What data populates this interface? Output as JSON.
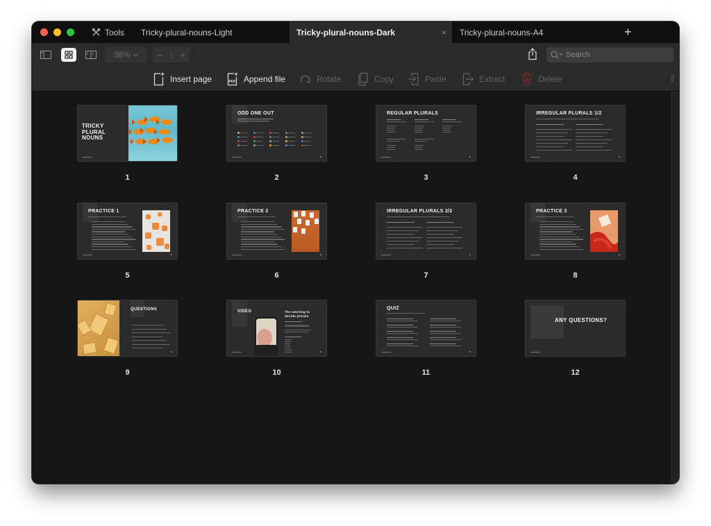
{
  "window": {
    "tools_label": "Tools",
    "tabs": [
      {
        "label": "Tricky-plural-nouns-Light",
        "active": false
      },
      {
        "label": "Tricky-plural-nouns-Dark",
        "active": true
      },
      {
        "label": "Tricky-plural-nouns-A4",
        "active": false
      }
    ],
    "close_tab_glyph": "×",
    "new_tab_glyph": "+"
  },
  "toolbar": {
    "view_modes": [
      {
        "icon": "sidebar-view-icon",
        "active": false
      },
      {
        "icon": "grid-view-icon",
        "active": true
      },
      {
        "icon": "two-page-view-icon",
        "active": false
      }
    ],
    "zoom_level": "38%",
    "zoom_minus": "−",
    "zoom_plus": "+",
    "search_placeholder": "Search"
  },
  "actions": [
    {
      "label": "Insert page",
      "icon": "insert-page-icon",
      "enabled": true
    },
    {
      "label": "Append file",
      "icon": "append-pdf-icon",
      "enabled": true
    },
    {
      "label": "Rotate",
      "icon": "rotate-icon",
      "enabled": false
    },
    {
      "label": "Copy",
      "icon": "copy-icon",
      "enabled": false
    },
    {
      "label": "Paste",
      "icon": "paste-icon",
      "enabled": false
    },
    {
      "label": "Extract",
      "icon": "extract-icon",
      "enabled": false
    },
    {
      "label": "Delete",
      "icon": "trash-icon",
      "enabled": false
    }
  ],
  "pages": [
    {
      "number": "1",
      "title": "TRICKY PLURAL NOUNS",
      "title_lines": [
        "TRICKY",
        "PLURAL",
        "NOUNS"
      ],
      "image": "goldfish"
    },
    {
      "number": "2",
      "title": "ODD ONE OUT"
    },
    {
      "number": "3",
      "title": "REGULAR PLURALS"
    },
    {
      "number": "4",
      "title": "IRREGULAR PLURALS 1/2"
    },
    {
      "number": "5",
      "title": "PRACTICE 1",
      "image": "orange-gummies"
    },
    {
      "number": "6",
      "title": "PRACTICE 2",
      "image": "white-chairs-orange"
    },
    {
      "number": "7",
      "title": "IRREGULAR PLURALS 2/2"
    },
    {
      "number": "8",
      "title": "PRACTICE 3",
      "image": "red-ribbon"
    },
    {
      "number": "9",
      "title": "QUESTIONS",
      "image": "yellow-books"
    },
    {
      "number": "10",
      "title": "VIDEO",
      "subtitle": "The meeting to decide plurals",
      "image": "phone-video"
    },
    {
      "number": "11",
      "title": "QUIZ"
    },
    {
      "number": "12",
      "title": "ANY QUESTIONS?"
    }
  ],
  "colors": {
    "accent_close": "#fe5f57",
    "accent_minimize": "#febc2e",
    "accent_zoom": "#28c840",
    "delete_icon": "#7a2a2a",
    "background": "#161616"
  }
}
